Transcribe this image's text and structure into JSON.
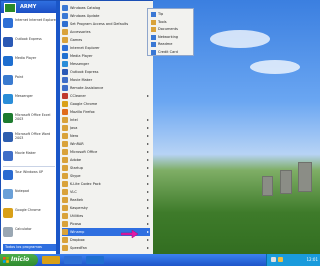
{
  "user": {
    "name": "ARMY"
  },
  "left_items": [
    {
      "label": "Internet\nInternet Explorer",
      "color": "#2d6fd6",
      "icon": "internet-explorer-icon"
    },
    {
      "label": "Outlook Express",
      "color": "#2b59b5",
      "icon": "mail-icon"
    },
    {
      "label": "Media Player",
      "color": "#1f6fd0",
      "icon": "media-player-icon"
    },
    {
      "label": "Paint",
      "color": "#3a7bd0",
      "icon": "paint-icon"
    },
    {
      "label": "Messenger",
      "color": "#2a8dd8",
      "icon": "messenger-icon"
    },
    {
      "label": "Microsoft Office Excel 2003",
      "color": "#1d7b2f",
      "icon": "excel-icon"
    },
    {
      "label": "Microsoft Office Word 2003",
      "color": "#2f5fb0",
      "icon": "word-icon"
    },
    {
      "label": "Movie Maker",
      "color": "#3f6ec8",
      "icon": "movie-maker-icon"
    },
    {
      "label": "Tour Windows XP",
      "color": "#2a6bd1",
      "icon": "tour-icon"
    },
    {
      "label": "Notepad",
      "color": "#6aa0d8",
      "icon": "notepad-icon"
    },
    {
      "label": "Google Chrome",
      "color": "#d9a018",
      "icon": "chrome-icon"
    },
    {
      "label": "Calculator",
      "color": "#9aa7b3",
      "icon": "calculator-icon"
    }
  ],
  "all_programs_label": "Todos los programas",
  "programs": [
    {
      "label": "Windows Catalog",
      "color": "#3a78d4",
      "arrow": false
    },
    {
      "label": "Windows Update",
      "color": "#3a78d4",
      "arrow": false
    },
    {
      "label": "Set Program Access and Defaults",
      "color": "#2f6fd0",
      "arrow": false
    },
    {
      "label": "Accessories",
      "color": "#d9a23a",
      "arrow": true
    },
    {
      "label": "Games",
      "color": "#d9a23a",
      "arrow": true
    },
    {
      "label": "Internet Explorer",
      "color": "#2d6fd6",
      "arrow": false
    },
    {
      "label": "Media Player",
      "color": "#1f6fd0",
      "arrow": false
    },
    {
      "label": "Messenger",
      "color": "#2a8dd8",
      "arrow": false
    },
    {
      "label": "Outlook Express",
      "color": "#2b59b5",
      "arrow": false
    },
    {
      "label": "Movie Maker",
      "color": "#3f6ec8",
      "arrow": false
    },
    {
      "label": "Remote Assistance",
      "color": "#3f6ec8",
      "arrow": false
    },
    {
      "label": "CCleaner",
      "color": "#c0392b",
      "arrow": true
    },
    {
      "label": "Google Chrome",
      "color": "#d9a018",
      "arrow": false
    },
    {
      "label": "Mozilla Firefox",
      "color": "#e06c1a",
      "arrow": false
    },
    {
      "label": "Intel",
      "color": "#d9a23a",
      "arrow": true
    },
    {
      "label": "Java",
      "color": "#d9a23a",
      "arrow": true
    },
    {
      "label": "Nero",
      "color": "#d9a23a",
      "arrow": true
    },
    {
      "label": "WinRAR",
      "color": "#d9a23a",
      "arrow": true
    },
    {
      "label": "Microsoft Office",
      "color": "#d9a23a",
      "arrow": true
    },
    {
      "label": "Adobe",
      "color": "#d9a23a",
      "arrow": true
    },
    {
      "label": "Startup",
      "color": "#d9a23a",
      "arrow": true
    },
    {
      "label": "Skype",
      "color": "#d9a23a",
      "arrow": true
    },
    {
      "label": "K-Lite Codec Pack",
      "color": "#d9a23a",
      "arrow": true
    },
    {
      "label": "VLC",
      "color": "#d9a23a",
      "arrow": true
    },
    {
      "label": "Realtek",
      "color": "#d9a23a",
      "arrow": true
    },
    {
      "label": "Kaspersky",
      "color": "#d9a23a",
      "arrow": true
    },
    {
      "label": "Utilities",
      "color": "#d9a23a",
      "arrow": true
    },
    {
      "label": "Picasa",
      "color": "#d9a23a",
      "arrow": true
    },
    {
      "label": "Winamp",
      "color": "#d9a23a",
      "arrow": true
    },
    {
      "label": "Dropbox",
      "color": "#d9a23a",
      "arrow": true
    },
    {
      "label": "SpeedFan",
      "color": "#d9a23a",
      "arrow": true
    }
  ],
  "highlighted_index": 28,
  "submenu": [
    {
      "label": "Tip",
      "color": "#3a78d4"
    },
    {
      "label": "Tools",
      "color": "#d9a23a"
    },
    {
      "label": "Documents",
      "color": "#d9a23a"
    },
    {
      "label": "Networking",
      "color": "#3a78d4"
    },
    {
      "label": "Readme",
      "color": "#3a78d4"
    },
    {
      "label": "Credit Card",
      "color": "#3a78d4"
    }
  ],
  "taskbar": {
    "start_label": "Inicio",
    "clock": "12:01",
    "task_colors": [
      "#d9a018",
      "#2d6fd6",
      "#1f6fd0"
    ]
  }
}
